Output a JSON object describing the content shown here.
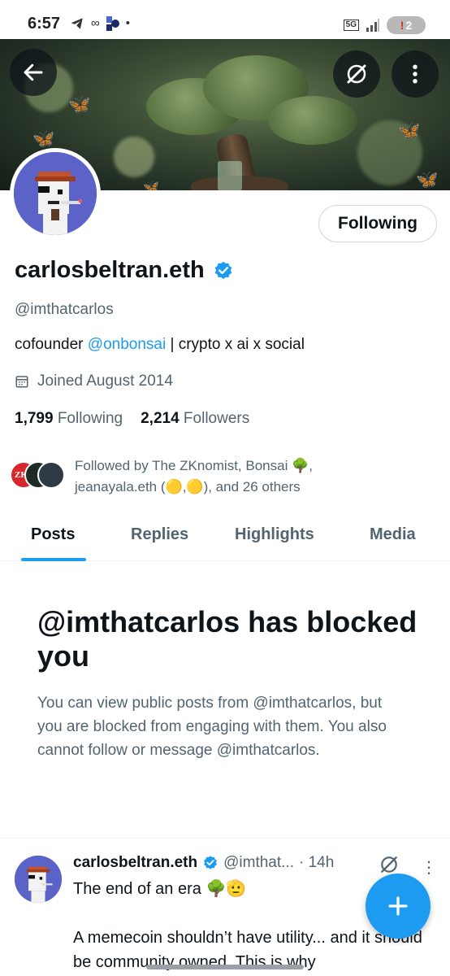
{
  "status_bar": {
    "time": "6:57",
    "left_icons": [
      "telegram-icon",
      "infinity-icon",
      "app-icon",
      "dot-icon"
    ],
    "network": "5G",
    "battery_badge": "2"
  },
  "profile": {
    "display_name": "carlosbeltran.eth",
    "verified": true,
    "handle": "@imthatcarlos",
    "bio_prefix": "cofounder ",
    "bio_mention": "@onbonsai",
    "bio_suffix": " | crypto x ai x social",
    "joined": "Joined August 2014",
    "following_count": "1,799",
    "following_label": "Following",
    "followers_count": "2,214",
    "followers_label": "Followers",
    "follow_button_label": "Following",
    "followed_by_line1": "Followed by The ZKnomist, Bonsai 🌳,",
    "followed_by_line2": "jeanayala.eth (🟡,🟡), and 26 others",
    "mini_avatar_label": "ZKn"
  },
  "tabs": [
    {
      "label": "Posts",
      "active": true
    },
    {
      "label": "Replies",
      "active": false
    },
    {
      "label": "Highlights",
      "active": false
    },
    {
      "label": "Media",
      "active": false
    }
  ],
  "blocked": {
    "title": "@imthatcarlos has blocked you",
    "body": "You can view public posts from @imthatcarlos, but you are blocked from engaging with them. You also cannot follow or message @imthatcarlos."
  },
  "tweet": {
    "name": "carlosbeltran.eth",
    "handle_truncated": "@imthat...",
    "time": "· 14h",
    "text1": "The end of an era 🌳🫡",
    "text2": "A memecoin shouldn’t have utility... and it should be community owned. This is why"
  },
  "colors": {
    "accent": "#1d9bf0",
    "text_primary": "#0f1419",
    "text_secondary": "#536471"
  }
}
